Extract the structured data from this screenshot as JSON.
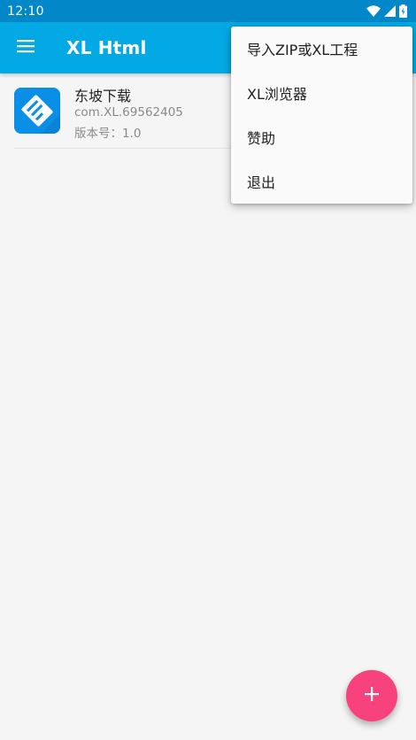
{
  "status_bar": {
    "time": "12:10",
    "icons": [
      "wifi-icon",
      "signal-icon",
      "battery-icon"
    ]
  },
  "app_bar": {
    "title": "XL Html",
    "menu_icon": "menu-icon",
    "color": "#03a9e4"
  },
  "projects": [
    {
      "name": "东坡下载",
      "package": "com.XL.69562405",
      "version": "版本号：1.0",
      "icon": "app-icon"
    }
  ],
  "popup_menu": {
    "items": [
      {
        "label": "导入ZIP或XL工程"
      },
      {
        "label": "XL浏览器"
      },
      {
        "label": "赞助"
      },
      {
        "label": "退出"
      }
    ]
  },
  "fab": {
    "icon": "plus-icon",
    "color": "#f8427d"
  }
}
